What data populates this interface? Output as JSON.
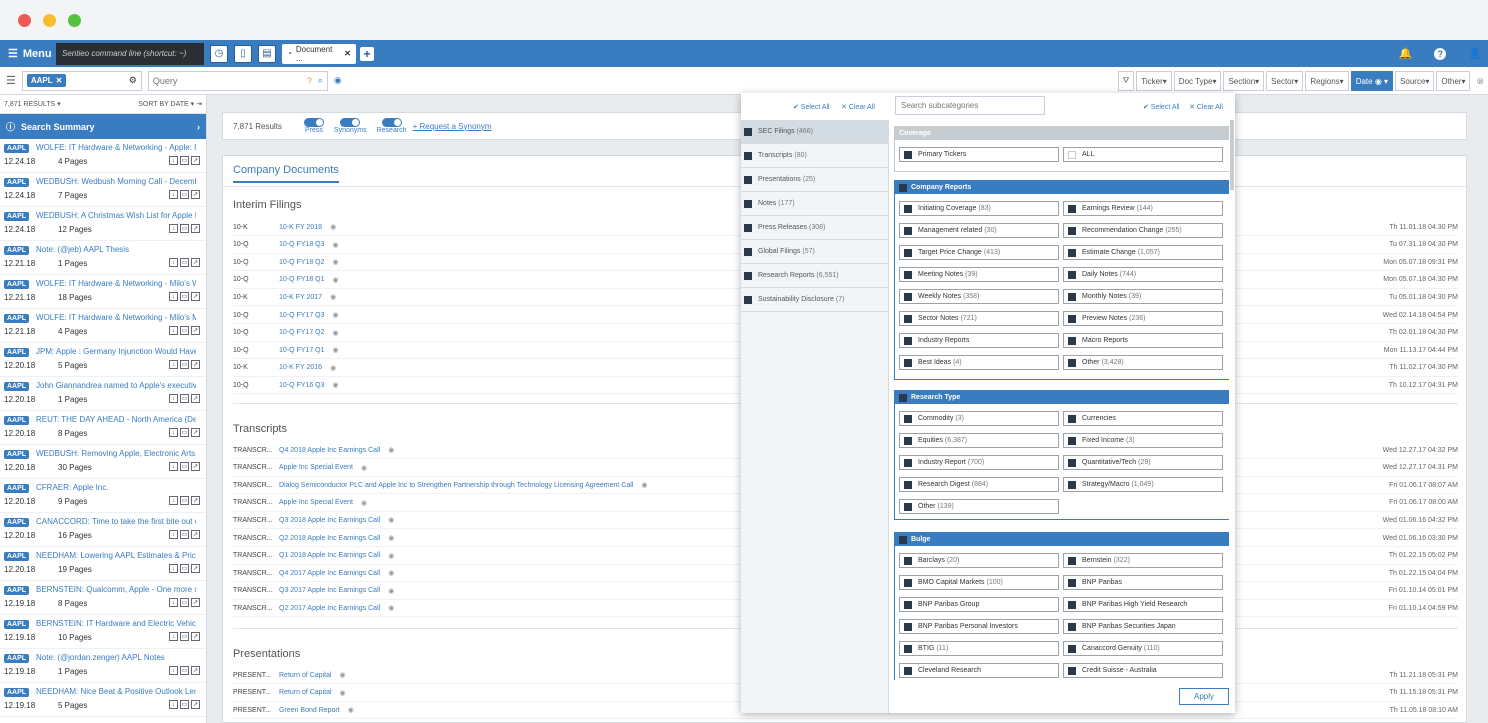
{
  "nav": {
    "menu": "Menu",
    "command_placeholder": "Sentieo command line (shortcut: ~)",
    "doc_tab": "Document ...",
    "close": "✕",
    "plus": "+"
  },
  "toolbar": {
    "ticker": "AAPL",
    "query_placeholder": "Query",
    "filters": [
      "Ticker",
      "Doc Type",
      "Section",
      "Sector",
      "Regions",
      "Date",
      "Source",
      "Other"
    ],
    "active_filter": "Date"
  },
  "left": {
    "results": "7,871 RESULTS",
    "sort": "SORT BY DATE",
    "summary": "Search Summary",
    "items": [
      {
        "ticker": "AAPL",
        "title": "WOLFE: IT Hardware & Networking - Apple: Is...",
        "date": "12.24.18",
        "pages": "4 Pages"
      },
      {
        "ticker": "AAPL",
        "title": "WEDBUSH: Wedbush Morning Call - Decemb...",
        "date": "12.24.18",
        "pages": "7 Pages"
      },
      {
        "ticker": "AAPL",
        "title": "WEDBUSH: A Christmas Wish List for Apple I...",
        "date": "12.24.18",
        "pages": "12 Pages"
      },
      {
        "ticker": "AAPL",
        "title": "Note: (@jeb) AAPL Thesis",
        "date": "12.21.18",
        "pages": "1 Pages"
      },
      {
        "ticker": "AAPL",
        "title": "WOLFE: IT Hardware & Networking - Milo's W...",
        "date": "12.21.18",
        "pages": "18 Pages"
      },
      {
        "ticker": "AAPL",
        "title": "WOLFE: IT Hardware & Networking - Milo's M...",
        "date": "12.21.18",
        "pages": "4 Pages"
      },
      {
        "ticker": "AAPL",
        "title": "JPM: Apple : Germany Injunction Would Have ...",
        "date": "12.20.18",
        "pages": "5 Pages"
      },
      {
        "ticker": "AAPL",
        "title": "John Giannandrea named to Apple's executive...",
        "date": "12.20.18",
        "pages": "1 Pages"
      },
      {
        "ticker": "AAPL",
        "title": "REUT: THE DAY AHEAD - North America (De...",
        "date": "12.20.18",
        "pages": "8 Pages"
      },
      {
        "ticker": "AAPL",
        "title": "WEDBUSH: Removing Apple, Electronic Arts, ...",
        "date": "12.20.18",
        "pages": "30 Pages"
      },
      {
        "ticker": "AAPL",
        "title": "CFRAER: Apple Inc.",
        "date": "12.20.18",
        "pages": "9 Pages"
      },
      {
        "ticker": "AAPL",
        "title": "CANACCORD: Time to take the first bite out of...",
        "date": "12.20.18",
        "pages": "16 Pages"
      },
      {
        "ticker": "AAPL",
        "title": "NEEDHAM: Lowering AAPL Estimates & Price...",
        "date": "12.20.18",
        "pages": "19 Pages"
      },
      {
        "ticker": "AAPL",
        "title": "BERNSTEIN: Qualcomm, Apple - One more s...",
        "date": "12.19.18",
        "pages": "8 Pages"
      },
      {
        "ticker": "AAPL",
        "title": "BERNSTEIN: IT Hardware and Electric Vehicl...",
        "date": "12.19.18",
        "pages": "10 Pages"
      },
      {
        "ticker": "AAPL",
        "title": "Note: (@jordan.zenger) AAPL Notes",
        "date": "12.19.18",
        "pages": "1 Pages"
      },
      {
        "ticker": "AAPL",
        "title": "NEEDHAM: Nice Beat & Positive Outlook Len...",
        "date": "12.19.18",
        "pages": "5 Pages"
      }
    ]
  },
  "main": {
    "count": "7,871 Results",
    "toggles": [
      "Press",
      "Synonyms",
      "Research"
    ],
    "synonym_link": "+ Request a Synonym",
    "company_docs": "Company Documents",
    "interim": {
      "title": "Interim Filings",
      "rows": [
        {
          "t": "10-K",
          "n": "10-K FY 2018",
          "d": "Th 11.01.18 04:30 PM"
        },
        {
          "t": "10-Q",
          "n": "10-Q FY18 Q3",
          "d": "Tu 07.31.18 04:30 PM"
        },
        {
          "t": "10-Q",
          "n": "10-Q FY18 Q2",
          "d": "Mon 05.07.18 09:31 PM"
        },
        {
          "t": "10-Q",
          "n": "10-Q FY18 Q1",
          "d": "Mon 05.07.18 04:30 PM"
        },
        {
          "t": "10-K",
          "n": "10-K FY 2017",
          "d": "Tu 05.01.18 04:30 PM"
        },
        {
          "t": "10-Q",
          "n": "10-Q FY17 Q3",
          "d": "Wed 02.14.18 04:54 PM"
        },
        {
          "t": "10-Q",
          "n": "10-Q FY17 Q2",
          "d": "Th 02.01.18 04:30 PM"
        },
        {
          "t": "10-Q",
          "n": "10-Q FY17 Q1",
          "d": "Mon 11.13.17 04:44 PM"
        },
        {
          "t": "10-K",
          "n": "10-K FY 2016",
          "d": "Th 11.02.17 04:30 PM"
        },
        {
          "t": "10-Q",
          "n": "10-Q FY16 Q3",
          "d": "Th 10.12.17 04:31 PM"
        }
      ]
    },
    "transcripts": {
      "title": "Transcripts",
      "rows": [
        {
          "t": "TRANSCR...",
          "n": "Q4 2018 Apple Inc Earnings Call",
          "d": "Wed 12.27.17 04:32 PM"
        },
        {
          "t": "TRANSCR...",
          "n": "Apple Inc Special Event",
          "d": "Wed 12.27.17 04:31 PM"
        },
        {
          "t": "TRANSCR...",
          "n": "Dialog Semiconductor PLC and Apple Inc to Strengthen Partnership through Technology Licensing Agreement Call",
          "d": "Fri 01.06.17 08:07 AM"
        },
        {
          "t": "TRANSCR...",
          "n": "Apple Inc Special Event",
          "d": "Fri 01.06.17 08:00 AM"
        },
        {
          "t": "TRANSCR...",
          "n": "Q3 2018 Apple Inc Earnings Call",
          "d": "Wed 01.06.16 04:32 PM"
        },
        {
          "t": "TRANSCR...",
          "n": "Q2 2018 Apple Inc Earnings Call",
          "d": "Wed 01.06.16 03:30 PM"
        },
        {
          "t": "TRANSCR...",
          "n": "Q1 2018 Apple Inc Earnings Call",
          "d": "Th 01.22.15 05:02 PM"
        },
        {
          "t": "TRANSCR...",
          "n": "Q4 2017 Apple Inc Earnings Call",
          "d": "Th 01.22.15 04:04 PM"
        },
        {
          "t": "TRANSCR...",
          "n": "Q3 2017 Apple Inc Earnings Call",
          "d": "Fri 01.10.14 05:01 PM"
        },
        {
          "t": "TRANSCR...",
          "n": "Q2 2017 Apple Inc Earnings Call",
          "d": "Fri 01.10.14 04:59 PM"
        }
      ]
    },
    "presentations": {
      "title": "Presentations",
      "rows": [
        {
          "t": "PRESENT...",
          "n": "Return of Capital",
          "d": "Th 11.21.18 05:31 PM"
        },
        {
          "t": "PRESENT...",
          "n": "Return of Capital",
          "d": "Th 11.15.18 05:31 PM"
        },
        {
          "t": "PRESENT...",
          "n": "Green Bond Report",
          "d": "Th 11.05.18 08:10 AM"
        }
      ]
    }
  },
  "overlay": {
    "select_all": "✔ Select All",
    "clear_all": "✕ Clear All",
    "search_placeholder": "Search subcategories",
    "apply": "Apply",
    "categories": [
      {
        "l": "SEC Filings",
        "c": "(466)"
      },
      {
        "l": "Transcripts",
        "c": "(80)"
      },
      {
        "l": "Presentations",
        "c": "(25)"
      },
      {
        "l": "Notes",
        "c": "(177)"
      },
      {
        "l": "Press Releases",
        "c": "(308)"
      },
      {
        "l": "Global Filings",
        "c": "(57)"
      },
      {
        "l": "Research Reports",
        "c": "(6,551)"
      },
      {
        "l": "Sustainability Disclosure",
        "c": "(7)"
      }
    ],
    "coverage": {
      "title": "Coverage",
      "items": [
        {
          "l": "Primary Tickers",
          "c": ""
        },
        {
          "l": "ALL",
          "c": ""
        }
      ]
    },
    "company_reports": {
      "title": "Company Reports",
      "items": [
        {
          "l": "Initiating Coverage",
          "c": "(83)"
        },
        {
          "l": "Earnings Review",
          "c": "(144)"
        },
        {
          "l": "Management related",
          "c": "(30)"
        },
        {
          "l": "Recommendation Change",
          "c": "(255)"
        },
        {
          "l": "Target Price Change",
          "c": "(413)"
        },
        {
          "l": "Estimate Change",
          "c": "(1,057)"
        },
        {
          "l": "Meeting Notes",
          "c": "(39)"
        },
        {
          "l": "Daily Notes",
          "c": "(744)"
        },
        {
          "l": "Weekly Notes",
          "c": "(358)"
        },
        {
          "l": "Monthly Notes",
          "c": "(39)"
        },
        {
          "l": "Sector Notes",
          "c": "(721)"
        },
        {
          "l": "Preview Notes",
          "c": "(236)"
        },
        {
          "l": "Industry Reports",
          "c": ""
        },
        {
          "l": "Macro Reports",
          "c": ""
        },
        {
          "l": "Best Ideas",
          "c": "(4)"
        },
        {
          "l": "Other",
          "c": "(3,428)"
        }
      ]
    },
    "research_type": {
      "title": "Research Type",
      "items": [
        {
          "l": "Commodity",
          "c": "(3)"
        },
        {
          "l": "Currencies",
          "c": ""
        },
        {
          "l": "Equities",
          "c": "(6,387)"
        },
        {
          "l": "Fixed Income",
          "c": "(3)"
        },
        {
          "l": "Industry Report",
          "c": "(700)"
        },
        {
          "l": "Quantitative/Tech",
          "c": "(29)"
        },
        {
          "l": "Research Digest",
          "c": "(884)"
        },
        {
          "l": "Strategy/Macro",
          "c": "(1,049)"
        },
        {
          "l": "Other",
          "c": "(139)"
        }
      ]
    },
    "bulge": {
      "title": "Bulge",
      "items": [
        {
          "l": "Barclays",
          "c": "(20)"
        },
        {
          "l": "Bernstein",
          "c": "(322)"
        },
        {
          "l": "BMO Capital Markets",
          "c": "(100)"
        },
        {
          "l": "BNP Paribas",
          "c": ""
        },
        {
          "l": "BNP Paribas Group",
          "c": ""
        },
        {
          "l": "BNP Paribas High Yield Research",
          "c": ""
        },
        {
          "l": "BNP Paribas Personal Investors",
          "c": ""
        },
        {
          "l": "BNP Paribas Securities Japan",
          "c": ""
        },
        {
          "l": "BTIG",
          "c": "(11)"
        },
        {
          "l": "Canaccord Genuity",
          "c": "(110)"
        },
        {
          "l": "Cleveland Research",
          "c": ""
        },
        {
          "l": "Credit Suisse - Australia",
          "c": ""
        }
      ]
    }
  }
}
